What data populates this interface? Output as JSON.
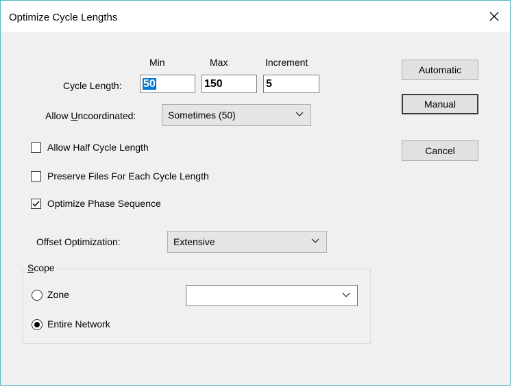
{
  "window": {
    "title": "Optimize Cycle Lengths"
  },
  "cycle": {
    "label": "Cycle Length:",
    "min_header": "Min",
    "max_header": "Max",
    "inc_header": "Increment",
    "min_value": "50",
    "max_value": "150",
    "inc_value": "5"
  },
  "uncoordinated": {
    "label_pre": "Allow ",
    "label_ul": "U",
    "label_post": "ncoordinated:",
    "value": "Sometimes (50)"
  },
  "options": {
    "half_cycle": "Allow Half Cycle Length",
    "half_cycle_checked": false,
    "preserve_files": "Preserve Files For Each Cycle Length",
    "preserve_files_checked": false,
    "phase_sequence": "Optimize Phase Sequence",
    "phase_sequence_checked": true
  },
  "offset": {
    "label": "Offset Optimization:",
    "value": "Extensive"
  },
  "scope": {
    "legend_ul": "S",
    "legend_rest": "cope",
    "zone_label": "Zone",
    "zone_selected": false,
    "zone_value": "",
    "network_label": "Entire Network",
    "network_selected": true
  },
  "buttons": {
    "automatic": "Automatic",
    "manual": "Manual",
    "cancel": "Cancel"
  },
  "icons": {
    "close": "close-icon",
    "chevron": "chevron-down-icon",
    "check": "checkmark-icon"
  }
}
